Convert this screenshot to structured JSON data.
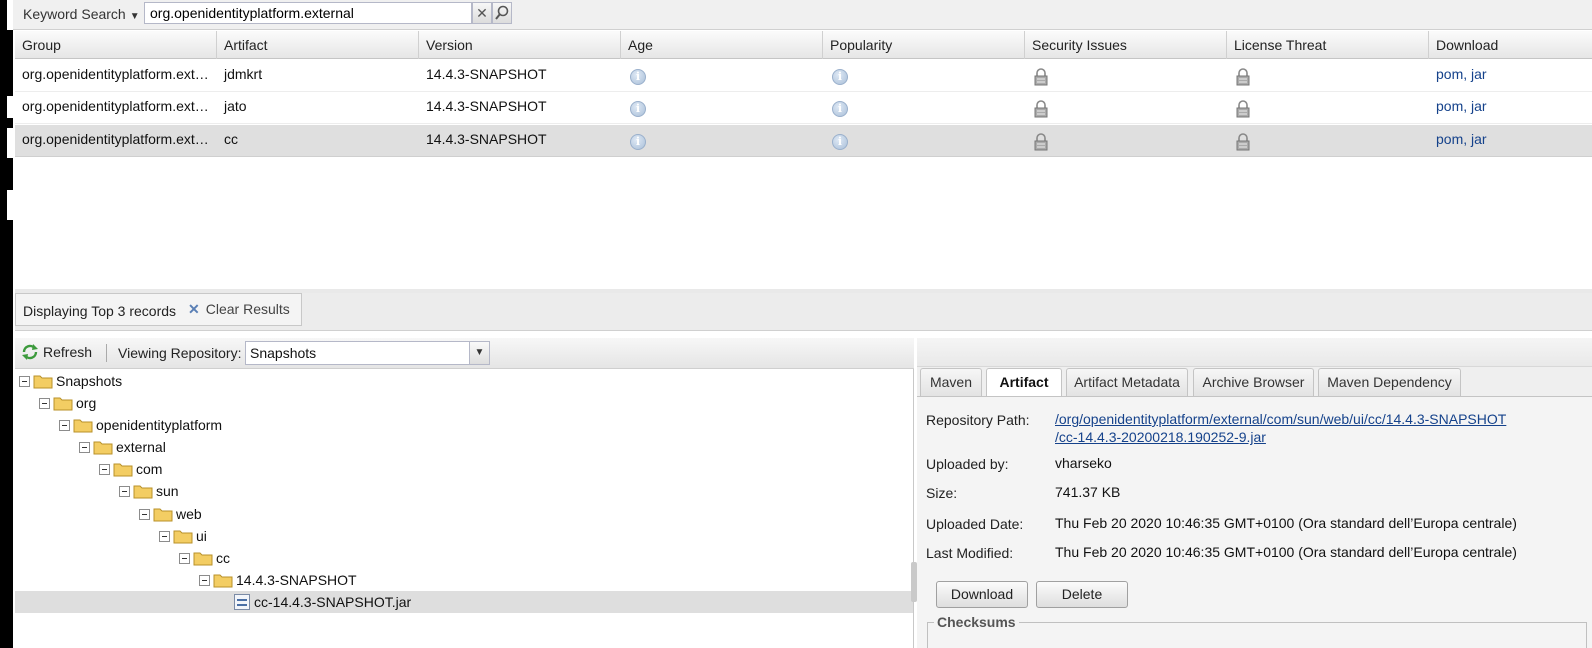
{
  "search": {
    "mode_label": "Keyword Search",
    "query": "org.openidentityplatform.external"
  },
  "grid": {
    "columns": [
      "Group",
      "Artifact",
      "Version",
      "Age",
      "Popularity",
      "Security Issues",
      "License Threat",
      "Download"
    ],
    "rows": [
      {
        "group": "org.openidentityplatform.ext…",
        "artifact": "jdmkrt",
        "version": "14.4.3-SNAPSHOT",
        "download_pom": "pom",
        "download_jar": "jar",
        "selected": false
      },
      {
        "group": "org.openidentityplatform.ext…",
        "artifact": "jato",
        "version": "14.4.3-SNAPSHOT",
        "download_pom": "pom",
        "download_jar": "jar",
        "selected": false
      },
      {
        "group": "org.openidentityplatform.ext…",
        "artifact": "cc",
        "version": "14.4.3-SNAPSHOT",
        "download_pom": "pom",
        "download_jar": "jar",
        "selected": true
      }
    ],
    "link_separator": ", "
  },
  "status": {
    "text": "Displaying Top 3 records",
    "clear_label": "Clear Results"
  },
  "tree_toolbar": {
    "refresh_label": "Refresh",
    "viewing_label": "Viewing Repository:",
    "repository": "Snapshots"
  },
  "tree": {
    "nodes": [
      "Snapshots",
      "org",
      "openidentityplatform",
      "external",
      "com",
      "sun",
      "web",
      "ui",
      "cc",
      "14.4.3-SNAPSHOT"
    ],
    "leaf": "cc-14.4.3-SNAPSHOT.jar"
  },
  "detail": {
    "tabs": [
      "Maven",
      "Artifact",
      "Artifact Metadata",
      "Archive Browser",
      "Maven Dependency"
    ],
    "active_tab": "Artifact",
    "repository_path_label": "Repository Path:",
    "repository_path_line1": "/org/openidentityplatform/external/com/sun/web/ui/cc/14.4.3-SNAPSHOT",
    "repository_path_line2": "/cc-14.4.3-20200218.190252-9.jar",
    "uploaded_by_label": "Uploaded by:",
    "uploaded_by": "vharseko",
    "size_label": "Size:",
    "size": "741.37 KB",
    "uploaded_date_label": "Uploaded Date:",
    "uploaded_date": "Thu Feb 20 2020 10:46:35 GMT+0100 (Ora standard dell’Europa centrale)",
    "last_modified_label": "Last Modified:",
    "last_modified": "Thu Feb 20 2020 10:46:35 GMT+0100 (Ora standard dell’Europa centrale)",
    "download_button": "Download",
    "delete_button": "Delete",
    "checksums_label": "Checksums"
  },
  "colors": {
    "link": "#15428b",
    "selected_row": "#dfdfdf",
    "info_icon": "#a9bfd8",
    "folder": "#f3cd63"
  },
  "icons": [
    "search-icon",
    "clear-icon",
    "info-icon",
    "lock-icon",
    "refresh-icon",
    "folder-icon",
    "jar-file-icon",
    "dropdown-arrow-icon"
  ]
}
